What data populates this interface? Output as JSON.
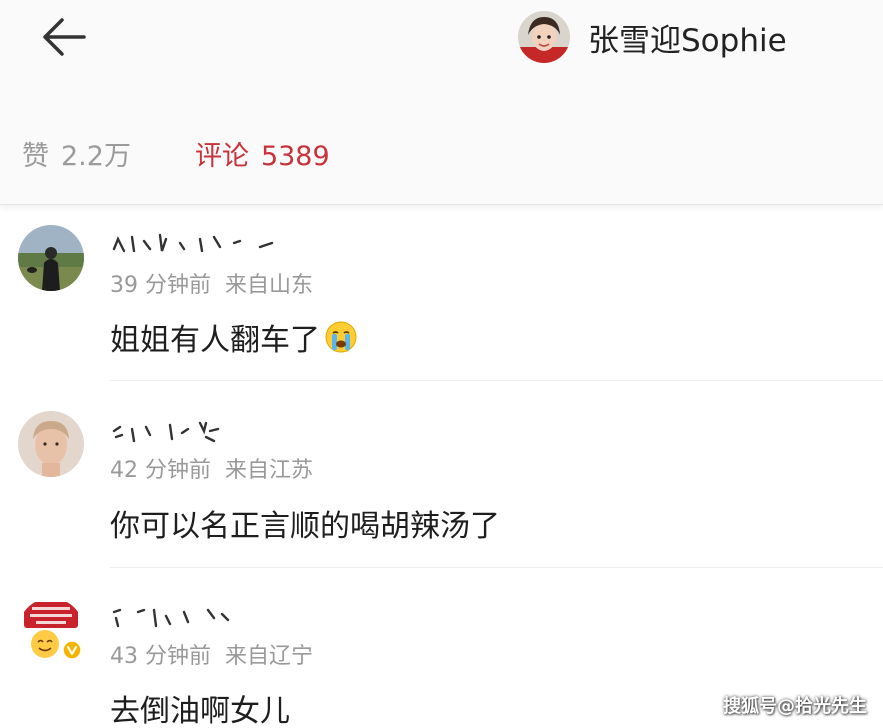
{
  "header": {
    "back_icon": "arrow-left-icon",
    "author_name": "张雪迎Sophie"
  },
  "stats": {
    "likes_label": "赞",
    "likes_count": "2.2万",
    "comments_label": "评论",
    "comments_count": "5389",
    "comments_color": "#c8323a"
  },
  "comments": [
    {
      "time": "39 分钟前",
      "location": "来自山东",
      "text": "姐姐有人翻车了",
      "emoji": "crying-face-icon"
    },
    {
      "time": "42 分钟前",
      "location": "来自江苏",
      "text": "你可以名正言顺的喝胡辣汤了"
    },
    {
      "time": "43 分钟前",
      "location": "来自辽宁",
      "text": "去倒油啊女儿",
      "badge": "verified-v-icon"
    }
  ],
  "watermark": "搜狐号@拾光先生"
}
